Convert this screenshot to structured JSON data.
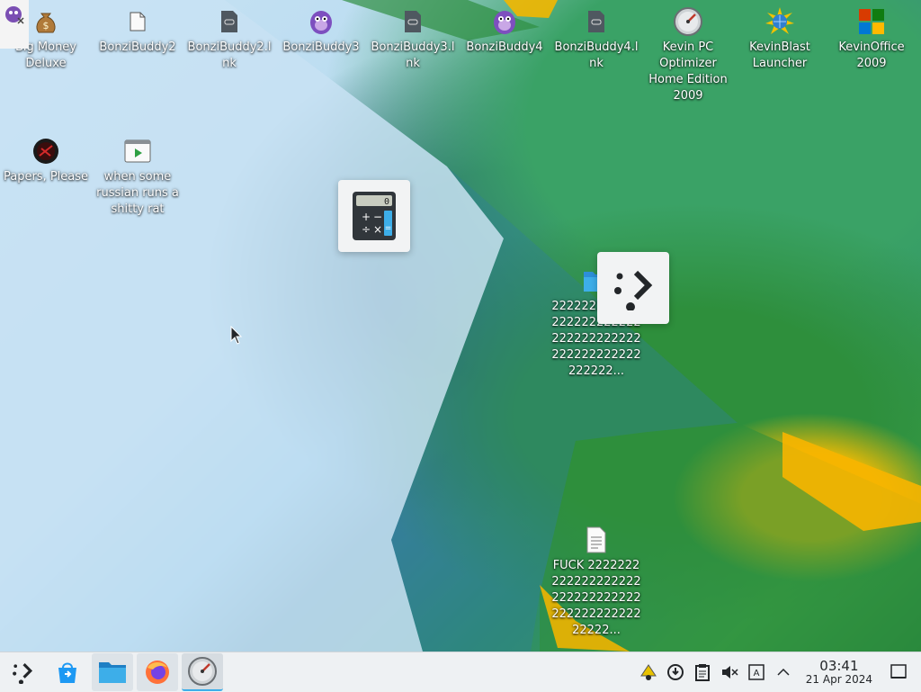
{
  "desktop": {
    "icons": [
      {
        "label": "Big Money Deluxe",
        "icon": "money-bag-icon"
      },
      {
        "label": "BonziBuddy2",
        "icon": "folder-icon"
      },
      {
        "label": "BonziBuddy2.lnk",
        "icon": "shortcut-file-icon"
      },
      {
        "label": "BonziBuddy3",
        "icon": "bonzi-purple-gorilla-icon"
      },
      {
        "label": "BonziBuddy3.lnk",
        "icon": "shortcut-file-icon"
      },
      {
        "label": "BonziBuddy4",
        "icon": "bonzi-purple-gorilla-icon"
      },
      {
        "label": "BonziBuddy4.lnk",
        "icon": "shortcut-file-icon"
      },
      {
        "label": "Kevin PC Optimizer Home Edition 2009",
        "icon": "gauge-icon"
      },
      {
        "label": "KevinBlast Launcher",
        "icon": "globe-burst-icon"
      },
      {
        "label": "KevinOffice 2009",
        "icon": "office-logo-icon"
      },
      {
        "label": "Papers, Please",
        "icon": "papers-please-icon"
      },
      {
        "label": "when some russian runs a shitty rat",
        "icon": "video-file-icon"
      },
      {
        "label": "222222222222222222222222222222222222222222222222222222...",
        "icon": "blue-folder-icon"
      },
      {
        "label": "FUCK 222222222222222222222222222222222222222222222222...",
        "icon": "text-document-icon"
      }
    ],
    "floating_tiles": [
      {
        "name": "calculator-tile",
        "icon": "calculator-icon",
        "display": "0"
      },
      {
        "name": "kde-launcher-tile",
        "icon": "kde-logo-icon"
      }
    ]
  },
  "taskbar": {
    "apps": [
      {
        "name": "application-launcher",
        "icon": "kde-logo-icon"
      },
      {
        "name": "discover",
        "icon": "store-bag-icon"
      },
      {
        "name": "file-manager",
        "icon": "folder-icon"
      },
      {
        "name": "firefox",
        "icon": "firefox-icon"
      },
      {
        "name": "kevin-pc-optimizer",
        "icon": "gauge-icon"
      }
    ],
    "tray": [
      {
        "name": "kde-connect",
        "icon": "kde-connect-icon"
      },
      {
        "name": "updates",
        "icon": "update-icon"
      },
      {
        "name": "clipboard",
        "icon": "clipboard-icon"
      },
      {
        "name": "volume",
        "icon": "speaker-muted-icon"
      },
      {
        "name": "input-method",
        "icon": "keyboard-icon"
      },
      {
        "name": "show-hidden",
        "icon": "chevron-up-icon"
      }
    ],
    "clock": {
      "time": "03:41",
      "date": "21 Apr 2024"
    },
    "show_desktop": "show-desktop-icon"
  },
  "colors": {
    "accent": "#3daee9",
    "panel_bg": "#eef1f3",
    "label_text": "#ffffff"
  }
}
